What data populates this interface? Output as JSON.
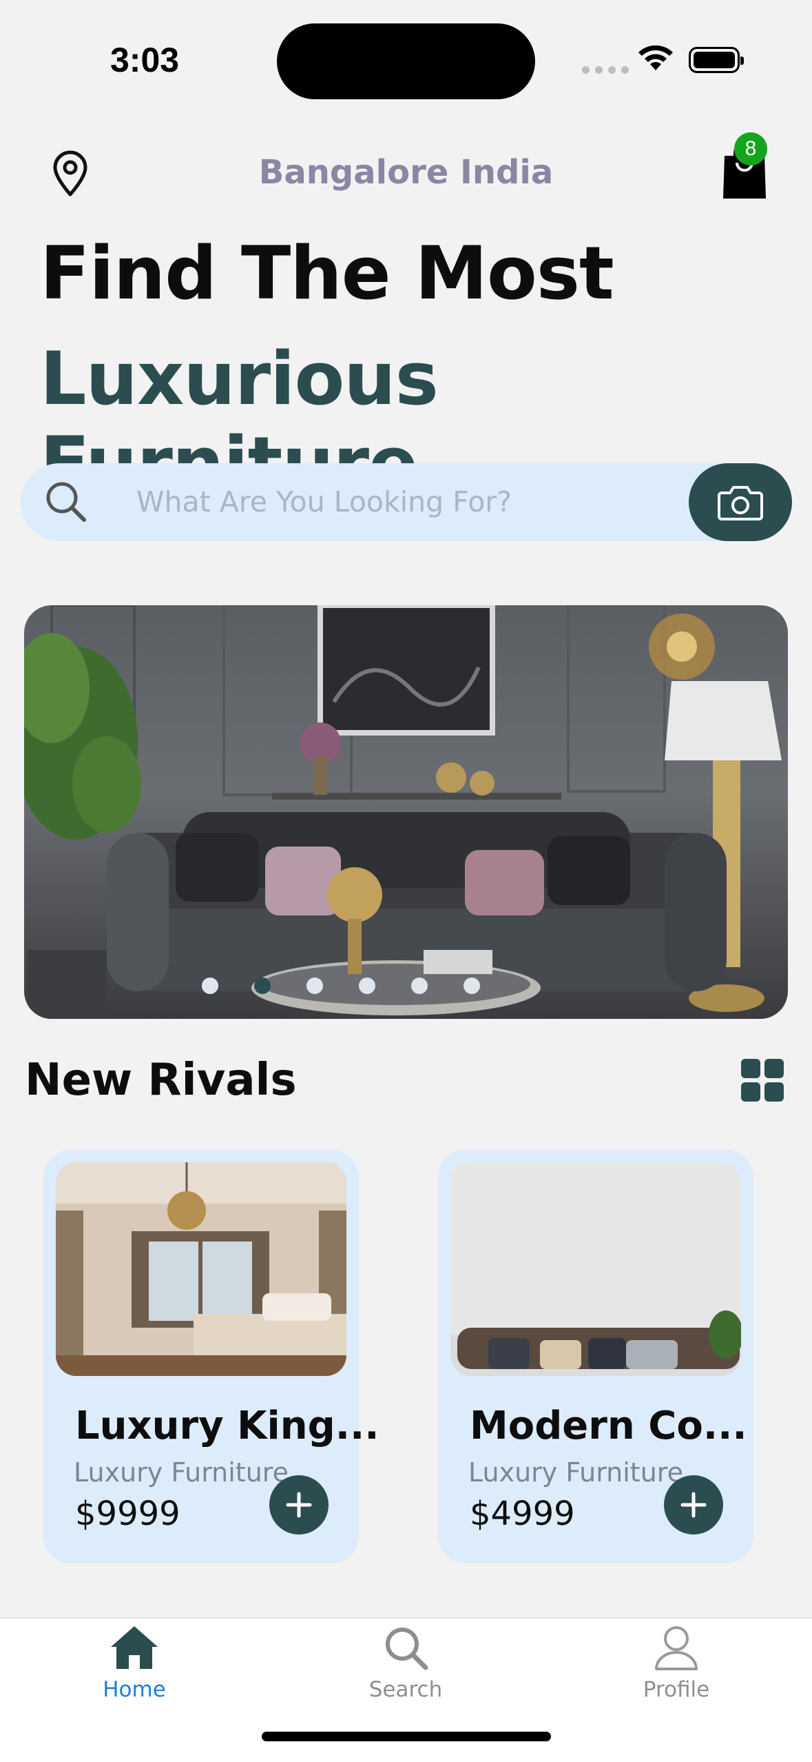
{
  "status_bar": {
    "time": "3:03"
  },
  "header": {
    "location": "Bangalore India",
    "cart_count": "8",
    "location_icon": "location-pin-icon",
    "cart_icon": "shopping-bag-icon"
  },
  "hero": {
    "line1": "Find The Most",
    "line2": "Luxurious Furniture"
  },
  "search": {
    "placeholder": "What Are You Looking For?",
    "value": ""
  },
  "banner": {
    "slides": 6,
    "active_slide": 2
  },
  "section": {
    "title": "New Rivals"
  },
  "products": [
    {
      "name": "Luxury King...",
      "category": "Luxury Furniture",
      "price": "$9999"
    },
    {
      "name": "Modern Co...",
      "category": "Luxury Furniture",
      "price": "$4999"
    }
  ],
  "tabs": [
    {
      "label": "Home",
      "icon": "home-icon",
      "active": true
    },
    {
      "label": "Search",
      "icon": "search-icon",
      "active": false
    },
    {
      "label": "Profile",
      "icon": "profile-icon",
      "active": false
    }
  ],
  "colors": {
    "accent": "#2b4d4f",
    "card_bg": "#dcecfb",
    "tab_active": "#1e7fd6",
    "tab_inactive": "#8e8e8e",
    "badge": "#15a51c"
  }
}
